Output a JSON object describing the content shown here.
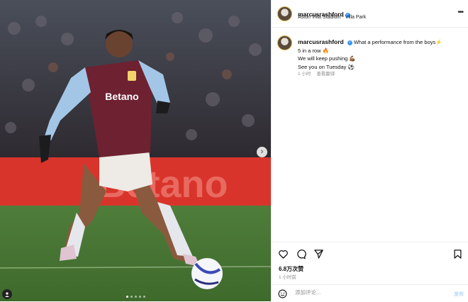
{
  "post": {
    "username": "marcusrashford",
    "location": "Aston Villa Stadium - Villa Park",
    "more_icon": "more-horizontal-icon",
    "caption": {
      "username": "marcusrashford",
      "line1": "What a performance from the boys⚡",
      "line2": "5 in a row 🔥",
      "line3": "We will keep pushing 💪🏾",
      "line4": "See you on Tuesday ⚽",
      "age": "1 小时",
      "translate": "查看翻译"
    },
    "photo": {
      "shirt_sponsor": "Betano",
      "board_text": "Betano",
      "carousel_index": 1,
      "carousel_count": 5
    },
    "actions": {
      "like_icon": "heart-icon",
      "comment_icon": "comment-icon",
      "share_icon": "send-icon",
      "save_icon": "bookmark-icon"
    },
    "likes": "6.8万次赞",
    "timestamp": "1 小时前",
    "comment": {
      "placeholder": "添加评论...",
      "post_label": "发布"
    }
  }
}
